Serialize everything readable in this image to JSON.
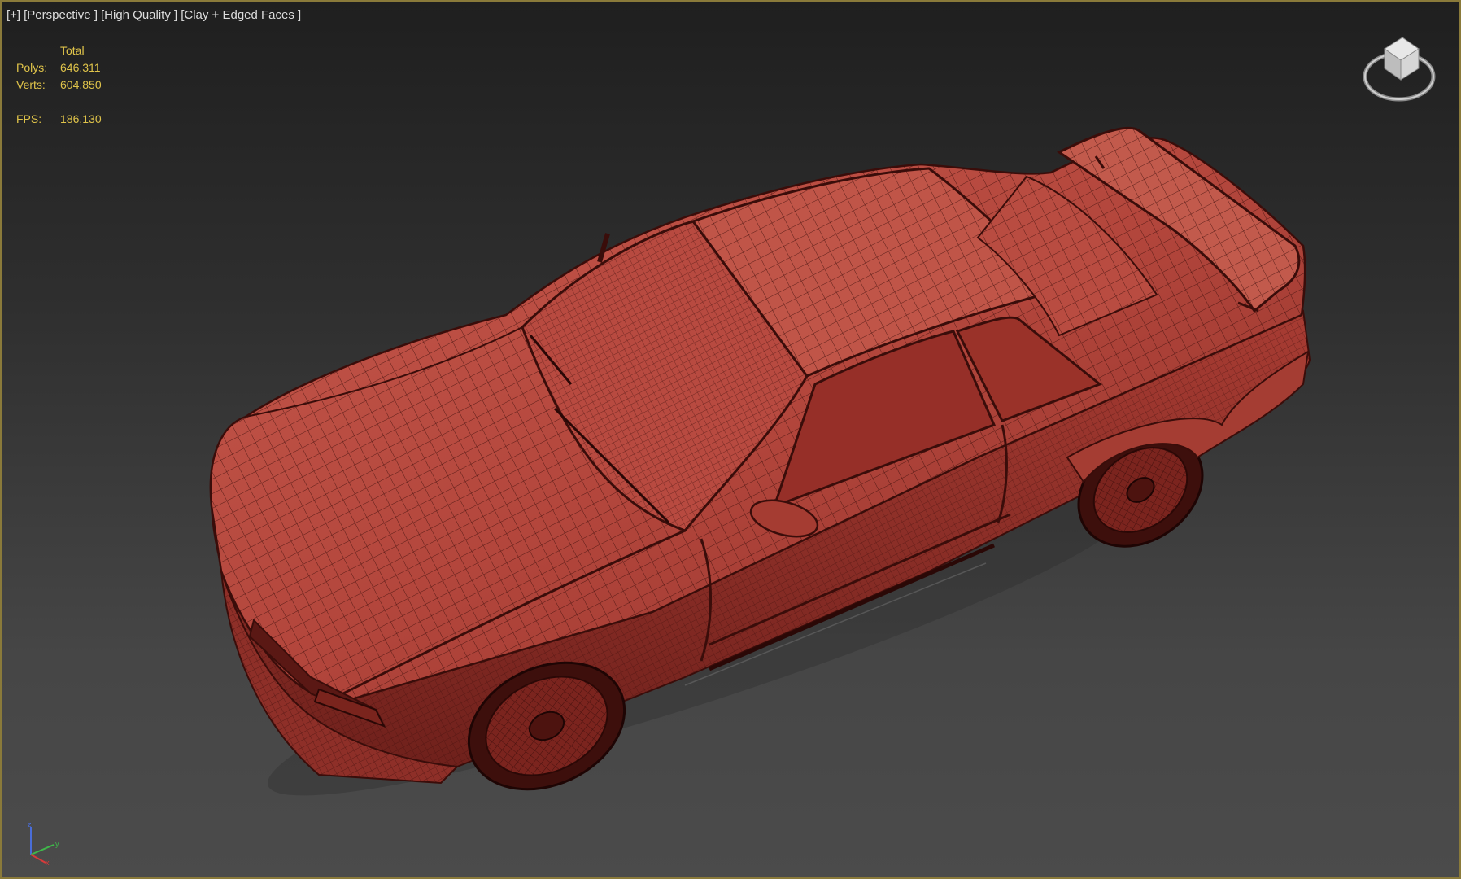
{
  "viewport": {
    "labels": [
      "[+]",
      "[Perspective ]",
      "[High Quality ]",
      "[Clay + Edged Faces ]"
    ]
  },
  "stats": {
    "header": "Total",
    "polys_label": "Polys:",
    "polys_value": "646.311",
    "verts_label": "Verts:",
    "verts_value": "604.850",
    "fps_label": "FPS:",
    "fps_value": "186,130"
  },
  "viewcube": {
    "icon": "viewcube-icon"
  },
  "tripod": {
    "icon": "axis-tripod-icon",
    "x_label": "x",
    "y_label": "y",
    "z_label": "z"
  },
  "colors": {
    "clay": "#b84a40",
    "wire": "#3a0d0a",
    "stats": "#e0c44a",
    "border": "#8a7a3a"
  }
}
